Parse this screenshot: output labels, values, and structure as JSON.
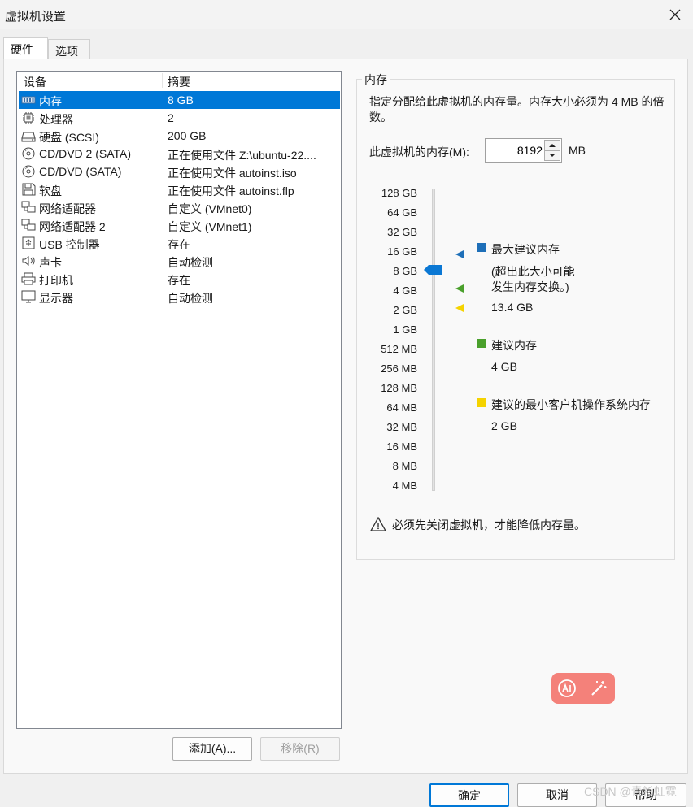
{
  "window": {
    "title": "虚拟机设置"
  },
  "tabs": [
    {
      "label": "硬件",
      "active": true
    },
    {
      "label": "选项",
      "active": false
    }
  ],
  "device_list": {
    "columns": [
      "设备",
      "摘要"
    ],
    "rows": [
      {
        "icon": "memory-icon",
        "name": "内存",
        "summary": "8 GB",
        "selected": true
      },
      {
        "icon": "cpu-icon",
        "name": "处理器",
        "summary": "2"
      },
      {
        "icon": "harddisk-icon",
        "name": "硬盘 (SCSI)",
        "summary": "200 GB"
      },
      {
        "icon": "cd-dvd-icon",
        "name": "CD/DVD 2 (SATA)",
        "summary": "正在使用文件 Z:\\ubuntu-22...."
      },
      {
        "icon": "cd-dvd-icon",
        "name": "CD/DVD (SATA)",
        "summary": "正在使用文件 autoinst.iso"
      },
      {
        "icon": "floppy-icon",
        "name": "软盘",
        "summary": "正在使用文件 autoinst.flp"
      },
      {
        "icon": "network-adapter-icon",
        "name": "网络适配器",
        "summary": "自定义 (VMnet0)"
      },
      {
        "icon": "network-adapter-icon",
        "name": "网络适配器 2",
        "summary": "自定义 (VMnet1)"
      },
      {
        "icon": "usb-icon",
        "name": "USB 控制器",
        "summary": "存在"
      },
      {
        "icon": "speaker-icon",
        "name": "声卡",
        "summary": "自动检测"
      },
      {
        "icon": "printer-icon",
        "name": "打印机",
        "summary": "存在"
      },
      {
        "icon": "monitor-icon",
        "name": "显示器",
        "summary": "自动检测"
      }
    ]
  },
  "list_buttons": {
    "add": "添加(A)...",
    "remove": "移除(R)"
  },
  "memory": {
    "group_title": "内存",
    "description": "指定分配给此虚拟机的内存量。内存大小必须为 4 MB 的倍数。",
    "input_label": "此虚拟机的内存(M):",
    "value": "8192",
    "unit": "MB",
    "scale_labels": [
      "128 GB",
      "64 GB",
      "32 GB",
      "16 GB",
      "8 GB",
      "4 GB",
      "2 GB",
      "1 GB",
      "512 MB",
      "256 MB",
      "128 MB",
      "64 MB",
      "32 MB",
      "16 MB",
      "8 MB",
      "4 MB"
    ],
    "slider_value": "8 GB",
    "legend": {
      "max_title": "最大建议内存",
      "max_note_line1": "(超出此大小可能",
      "max_note_line2": "发生内存交换。)",
      "max_value": "13.4 GB",
      "rec_title": "建议内存",
      "rec_value": "4 GB",
      "min_title": "建议的最小客户机操作系统内存",
      "min_value": "2 GB"
    },
    "warning": "必须先关闭虚拟机，才能降低内存量。"
  },
  "dialog_buttons": {
    "ok": "确定",
    "cancel": "取消",
    "help": "帮助"
  },
  "watermark": "CSDN @青衫虹霓",
  "colors": {
    "selection": "#0078d7",
    "max_marker": "#1e6fb8",
    "rec_marker": "#4aa02c",
    "min_marker": "#f5d300",
    "ai_badge": "#f4817a"
  }
}
